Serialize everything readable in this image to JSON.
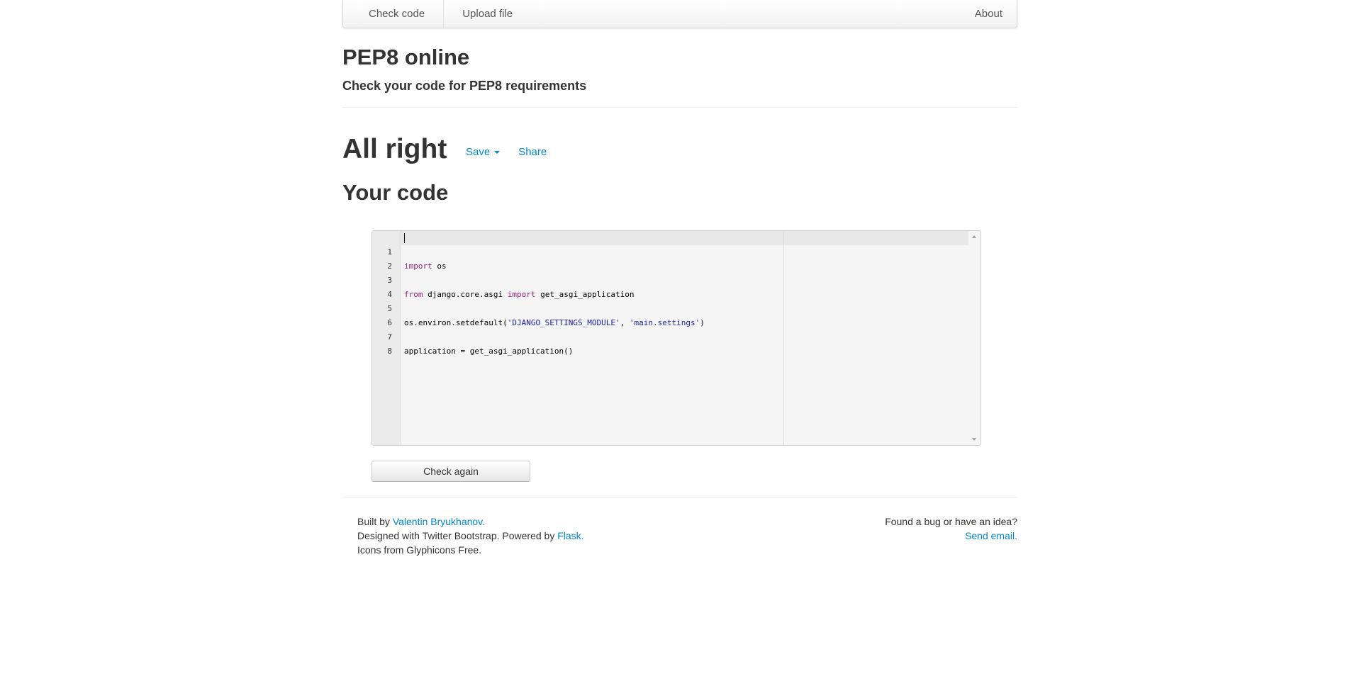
{
  "nav": {
    "check_code": "Check code",
    "upload_file": "Upload file",
    "about": "About"
  },
  "header": {
    "title": "PEP8 online",
    "subtitle": "Check your code for PEP8 requirements"
  },
  "result": {
    "title": "All right",
    "save_label": "Save",
    "share_label": "Share"
  },
  "code_section": {
    "title": "Your code",
    "lines": [
      {
        "num": "1"
      },
      {
        "num": "2"
      },
      {
        "num": "3"
      },
      {
        "num": "4"
      },
      {
        "num": "5"
      },
      {
        "num": "6"
      },
      {
        "num": "7"
      },
      {
        "num": "8"
      }
    ],
    "tokens": {
      "l1_kw": "import",
      "l1_rest": " os",
      "l3_kw1": "from",
      "l3_mid": " django.core.asgi ",
      "l3_kw2": "import",
      "l3_rest": " get_asgi_application",
      "l5_pre": "os.environ.setdefault(",
      "l5_str1": "'DJANGO_SETTINGS_MODULE'",
      "l5_mid": ", ",
      "l5_str2": "'main.settings'",
      "l5_post": ")",
      "l7": "application = get_asgi_application()"
    }
  },
  "check_again_label": "Check again",
  "footer": {
    "built_by": "Built by ",
    "author": "Valentin Bryukhanov",
    "period1": ".",
    "designed": "Designed with Twitter Bootstrap. Powered by ",
    "flask": "Flask",
    "period2": ".",
    "icons": "Icons from Glyphicons Free.",
    "bug_text": "Found a bug or have an idea?",
    "send_email": "Send email."
  },
  "colors": {
    "link": "#0088cc",
    "keyword": "#931f7d",
    "string": "#1a1aa6"
  }
}
